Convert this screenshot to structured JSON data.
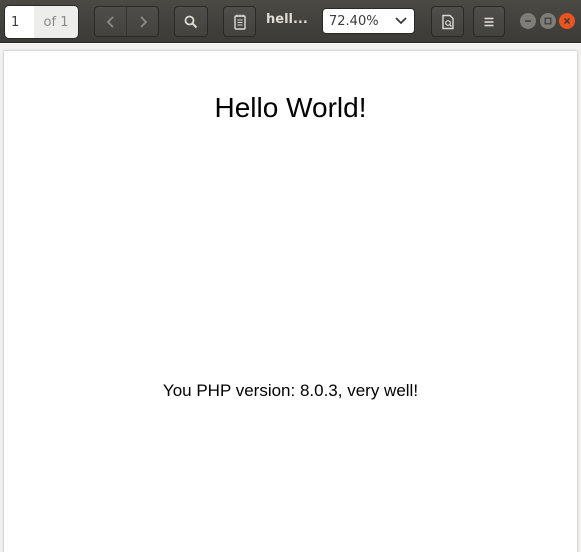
{
  "toolbar": {
    "page_current": "1",
    "page_total": "of 1",
    "document_title": "hell...",
    "zoom_level": "72.40%"
  },
  "icons": {
    "prev": "chevron-left-icon",
    "next": "chevron-right-icon",
    "search": "search-icon",
    "sidebar": "document-pages-icon",
    "annotate": "annotate-icon",
    "menu": "hamburger-menu-icon",
    "minimize": "minimize-icon",
    "maximize": "maximize-icon",
    "close": "close-icon"
  },
  "colors": {
    "headerbar": "#3c3b37",
    "close_button": "#e95420",
    "window_button": "#7e7d78"
  },
  "document": {
    "heading": "Hello World!",
    "body_text": "You PHP version: 8.0.3, very well!"
  }
}
